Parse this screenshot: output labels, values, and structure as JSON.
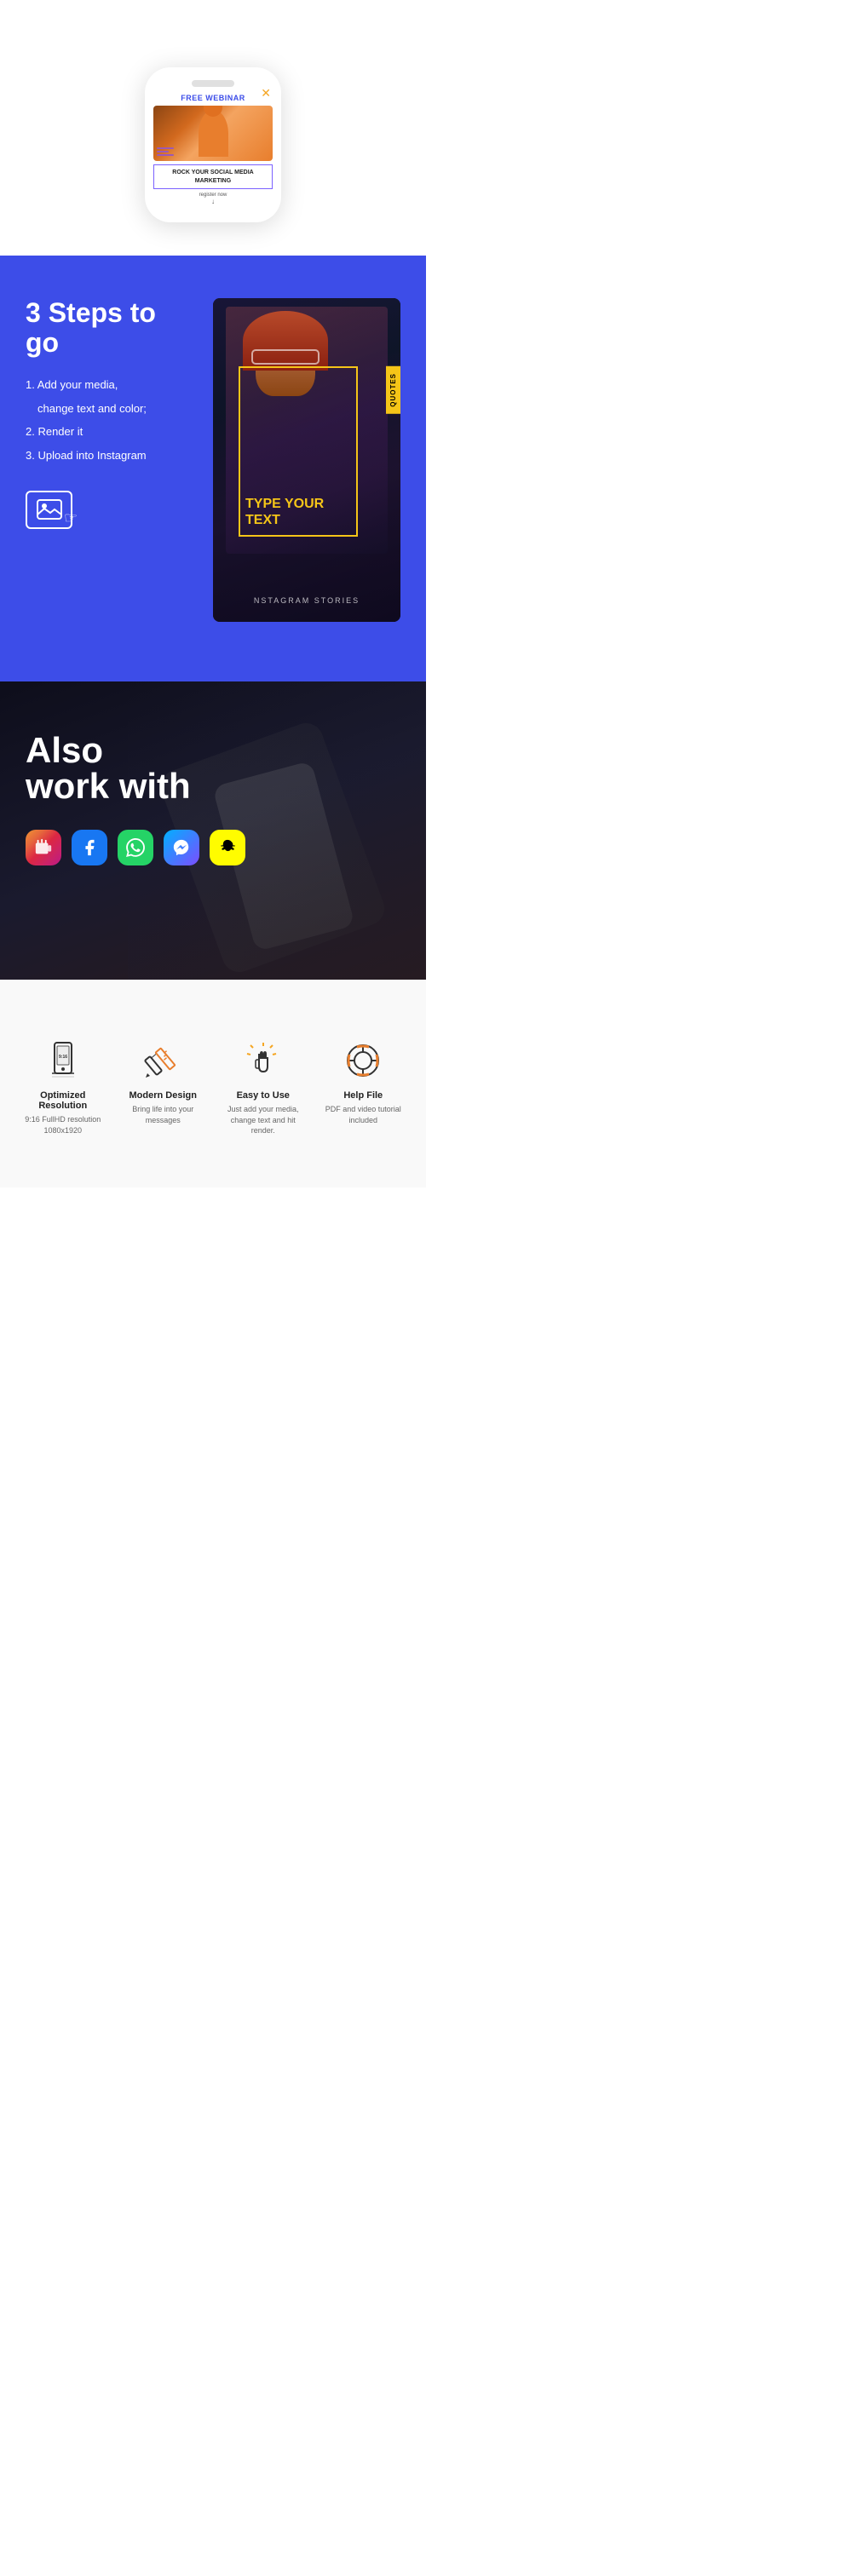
{
  "webinar": {
    "tag": "FREE WEBINAR",
    "title": "ROCK YOUR SOCIAL MEDIA MARKETING",
    "register": "register now"
  },
  "steps": {
    "title": "3 Steps to go",
    "list": [
      "1. Add your media,",
      "    change text and color;",
      "2. Render it",
      "3. Upload into Instagram"
    ]
  },
  "instagram_card": {
    "quotes_tab": "QUOTES",
    "type_text": "TYPE YOUR\nTEXT",
    "stories_label": "NSTAGRAM STORIES"
  },
  "social": {
    "title_line1": "Also",
    "title_line2": "work with",
    "icons": [
      {
        "name": "IGTV",
        "label": "igtv-icon"
      },
      {
        "name": "Facebook",
        "label": "facebook-icon"
      },
      {
        "name": "WhatsApp",
        "label": "whatsapp-icon"
      },
      {
        "name": "Messenger",
        "label": "messenger-icon"
      },
      {
        "name": "Snapchat",
        "label": "snapchat-icon"
      }
    ]
  },
  "features": [
    {
      "id": "optimized",
      "title": "Optimized Resolution",
      "desc": "9:16 FullHD resolution 1080x1920"
    },
    {
      "id": "modern",
      "title": "Modern Design",
      "desc": "Bring life into your messages"
    },
    {
      "id": "easy",
      "title": "Easy to Use",
      "desc": "Just add your media, change text and hit render."
    },
    {
      "id": "help",
      "title": "Help File",
      "desc": "PDF and video tutorial included"
    }
  ],
  "colors": {
    "blue": "#3d4de8",
    "yellow": "#f5c518",
    "dark": "#1a1a2e"
  }
}
